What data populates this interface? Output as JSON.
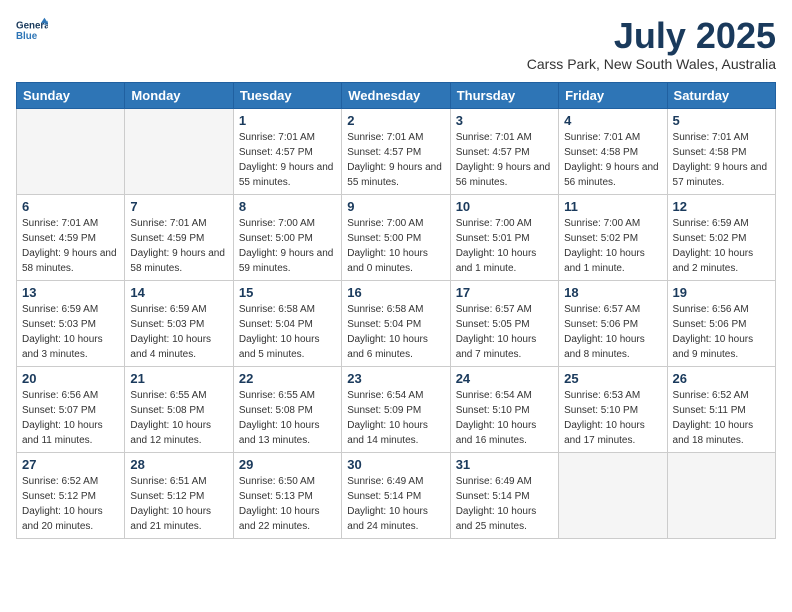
{
  "header": {
    "logo_line1": "General",
    "logo_line2": "Blue",
    "month_title": "July 2025",
    "location": "Carss Park, New South Wales, Australia"
  },
  "weekdays": [
    "Sunday",
    "Monday",
    "Tuesday",
    "Wednesday",
    "Thursday",
    "Friday",
    "Saturday"
  ],
  "weeks": [
    [
      {
        "day": "",
        "empty": true
      },
      {
        "day": "",
        "empty": true
      },
      {
        "day": "1",
        "sunrise": "7:01 AM",
        "sunset": "4:57 PM",
        "daylight": "9 hours and 55 minutes."
      },
      {
        "day": "2",
        "sunrise": "7:01 AM",
        "sunset": "4:57 PM",
        "daylight": "9 hours and 55 minutes."
      },
      {
        "day": "3",
        "sunrise": "7:01 AM",
        "sunset": "4:57 PM",
        "daylight": "9 hours and 56 minutes."
      },
      {
        "day": "4",
        "sunrise": "7:01 AM",
        "sunset": "4:58 PM",
        "daylight": "9 hours and 56 minutes."
      },
      {
        "day": "5",
        "sunrise": "7:01 AM",
        "sunset": "4:58 PM",
        "daylight": "9 hours and 57 minutes."
      }
    ],
    [
      {
        "day": "6",
        "sunrise": "7:01 AM",
        "sunset": "4:59 PM",
        "daylight": "9 hours and 58 minutes."
      },
      {
        "day": "7",
        "sunrise": "7:01 AM",
        "sunset": "4:59 PM",
        "daylight": "9 hours and 58 minutes."
      },
      {
        "day": "8",
        "sunrise": "7:00 AM",
        "sunset": "5:00 PM",
        "daylight": "9 hours and 59 minutes."
      },
      {
        "day": "9",
        "sunrise": "7:00 AM",
        "sunset": "5:00 PM",
        "daylight": "10 hours and 0 minutes."
      },
      {
        "day": "10",
        "sunrise": "7:00 AM",
        "sunset": "5:01 PM",
        "daylight": "10 hours and 1 minute."
      },
      {
        "day": "11",
        "sunrise": "7:00 AM",
        "sunset": "5:02 PM",
        "daylight": "10 hours and 1 minute."
      },
      {
        "day": "12",
        "sunrise": "6:59 AM",
        "sunset": "5:02 PM",
        "daylight": "10 hours and 2 minutes."
      }
    ],
    [
      {
        "day": "13",
        "sunrise": "6:59 AM",
        "sunset": "5:03 PM",
        "daylight": "10 hours and 3 minutes."
      },
      {
        "day": "14",
        "sunrise": "6:59 AM",
        "sunset": "5:03 PM",
        "daylight": "10 hours and 4 minutes."
      },
      {
        "day": "15",
        "sunrise": "6:58 AM",
        "sunset": "5:04 PM",
        "daylight": "10 hours and 5 minutes."
      },
      {
        "day": "16",
        "sunrise": "6:58 AM",
        "sunset": "5:04 PM",
        "daylight": "10 hours and 6 minutes."
      },
      {
        "day": "17",
        "sunrise": "6:57 AM",
        "sunset": "5:05 PM",
        "daylight": "10 hours and 7 minutes."
      },
      {
        "day": "18",
        "sunrise": "6:57 AM",
        "sunset": "5:06 PM",
        "daylight": "10 hours and 8 minutes."
      },
      {
        "day": "19",
        "sunrise": "6:56 AM",
        "sunset": "5:06 PM",
        "daylight": "10 hours and 9 minutes."
      }
    ],
    [
      {
        "day": "20",
        "sunrise": "6:56 AM",
        "sunset": "5:07 PM",
        "daylight": "10 hours and 11 minutes."
      },
      {
        "day": "21",
        "sunrise": "6:55 AM",
        "sunset": "5:08 PM",
        "daylight": "10 hours and 12 minutes."
      },
      {
        "day": "22",
        "sunrise": "6:55 AM",
        "sunset": "5:08 PM",
        "daylight": "10 hours and 13 minutes."
      },
      {
        "day": "23",
        "sunrise": "6:54 AM",
        "sunset": "5:09 PM",
        "daylight": "10 hours and 14 minutes."
      },
      {
        "day": "24",
        "sunrise": "6:54 AM",
        "sunset": "5:10 PM",
        "daylight": "10 hours and 16 minutes."
      },
      {
        "day": "25",
        "sunrise": "6:53 AM",
        "sunset": "5:10 PM",
        "daylight": "10 hours and 17 minutes."
      },
      {
        "day": "26",
        "sunrise": "6:52 AM",
        "sunset": "5:11 PM",
        "daylight": "10 hours and 18 minutes."
      }
    ],
    [
      {
        "day": "27",
        "sunrise": "6:52 AM",
        "sunset": "5:12 PM",
        "daylight": "10 hours and 20 minutes."
      },
      {
        "day": "28",
        "sunrise": "6:51 AM",
        "sunset": "5:12 PM",
        "daylight": "10 hours and 21 minutes."
      },
      {
        "day": "29",
        "sunrise": "6:50 AM",
        "sunset": "5:13 PM",
        "daylight": "10 hours and 22 minutes."
      },
      {
        "day": "30",
        "sunrise": "6:49 AM",
        "sunset": "5:14 PM",
        "daylight": "10 hours and 24 minutes."
      },
      {
        "day": "31",
        "sunrise": "6:49 AM",
        "sunset": "5:14 PM",
        "daylight": "10 hours and 25 minutes."
      },
      {
        "day": "",
        "empty": true
      },
      {
        "day": "",
        "empty": true
      }
    ]
  ],
  "labels": {
    "sunrise_prefix": "Sunrise: ",
    "sunset_prefix": "Sunset: ",
    "daylight_prefix": "Daylight: "
  }
}
